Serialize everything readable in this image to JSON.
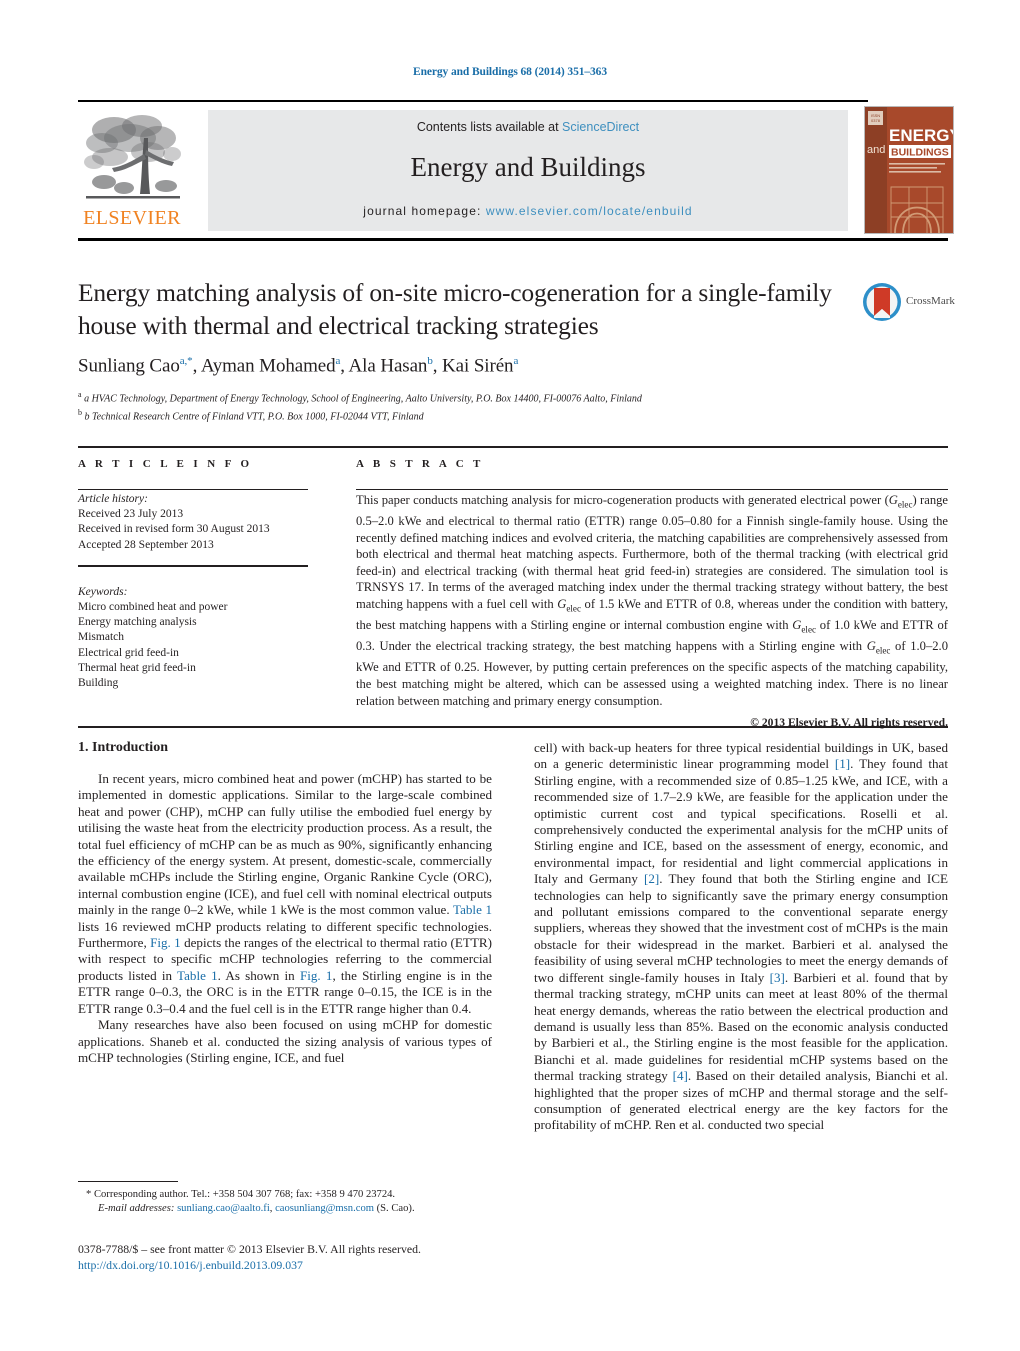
{
  "running_head": "Energy and Buildings 68 (2014) 351–363",
  "masthead": {
    "contents_prefix": "Contents lists available at ",
    "sciencedirect": "ScienceDirect",
    "journal_title": "Energy and Buildings",
    "homepage_prefix": "journal homepage: ",
    "homepage_url": "www.elsevier.com/locate/enbuild",
    "publisher": "ELSEVIER",
    "cover_line1": "ENERGY",
    "cover_line2": "and",
    "cover_line3": "BUILDINGS",
    "accent_orange": "#f08221",
    "link_blue": "#3e8fbf",
    "panel_grey": "#e7e8e9"
  },
  "crossmark": {
    "label": "CrossMark"
  },
  "title": "Energy matching analysis of on-site micro-cogeneration for a single-family house with thermal and electrical tracking strategies",
  "authors_html": "Sunliang Cao<sup>a,*</sup>, Ayman Mohamed<sup>a</sup>, Ala Hasan<sup>b</sup>, Kai Sirén<sup>a</sup>",
  "affiliations": [
    "a HVAC Technology, Department of Energy Technology, School of Engineering, Aalto University, P.O. Box 14400, FI-00076 Aalto, Finland",
    "b Technical Research Centre of Finland VTT, P.O. Box 1000, FI-02044 VTT, Finland"
  ],
  "article_info": {
    "heading": "A R T I C L E     I N F O",
    "history_label": "Article history:",
    "history": [
      "Received 23 July 2013",
      "Received in revised form 30 August 2013",
      "Accepted 28 September 2013"
    ],
    "keywords_label": "Keywords:",
    "keywords": [
      "Micro combined heat and power",
      "Energy matching analysis",
      "Mismatch",
      "Electrical grid feed-in",
      "Thermal heat grid feed-in",
      "Building"
    ]
  },
  "abstract": {
    "heading": "A B S T R A C T",
    "text": "This paper conducts matching analysis for micro-cogeneration products with generated electrical power (Gelec) range 0.5–2.0 kWe and electrical to thermal ratio (ETTR) range 0.05–0.80 for a Finnish single-family house. Using the recently defined matching indices and evolved criteria, the matching capabilities are comprehensively assessed from both electrical and thermal heat matching aspects. Furthermore, both of the thermal tracking (with electrical grid feed-in) and electrical tracking (with thermal heat grid feed-in) strategies are considered. The simulation tool is TRNSYS 17. In terms of the averaged matching index under the thermal tracking strategy without battery, the best matching happens with a fuel cell with Gelec of 1.5 kWe and ETTR of 0.8, whereas under the condition with battery, the best matching happens with a Stirling engine or internal combustion engine with Gelec of 1.0 kWe and ETTR of 0.3. Under the electrical tracking strategy, the best matching happens with a Stirling engine with Gelec of 1.0–2.0 kWe and ETTR of 0.25. However, by putting certain preferences on the specific aspects of the matching capability, the best matching might be altered, which can be assessed using a weighted matching index. There is no linear relation between matching and primary energy consumption.",
    "copyright": "© 2013 Elsevier B.V. All rights reserved."
  },
  "body": {
    "section_number_title": "1.  Introduction",
    "left_paragraph_1": "In recent years, micro combined heat and power (mCHP) has started to be implemented in domestic applications. Similar to the large-scale combined heat and power (CHP), mCHP can fully utilise the embodied fuel energy by utilising the waste heat from the electricity production process. As a result, the total fuel efficiency of mCHP can be as much as 90%, significantly enhancing the efficiency of the energy system. At present, domestic-scale, commercially available mCHPs include the Stirling engine, Organic Rankine Cycle (ORC), internal combustion engine (ICE), and fuel cell with nominal electrical outputs mainly in the range 0–2 kWe, while 1 kWe is the most common value. Table 1 lists 16 reviewed mCHP products relating to different specific technologies. Furthermore, Fig. 1 depicts the ranges of the electrical to thermal ratio (ETTR) with respect to specific mCHP technologies referring to the commercial products listed in Table 1. As shown in Fig. 1, the Stirling engine is in the ETTR range 0–0.3, the ORC is in the ETTR range 0–0.15, the ICE is in the ETTR range 0.3–0.4 and the fuel cell is in the ETTR range higher than 0.4.",
    "left_paragraph_2": "Many researches have also been focused on using mCHP for domestic applications. Shaneb et al. conducted the sizing analysis of various types of mCHP technologies (Stirling engine, ICE, and fuel",
    "right_paragraph": "cell) with back-up heaters for three typical residential buildings in UK, based on a generic deterministic linear programming model [1]. They found that Stirling engine, with a recommended size of 0.85–1.25 kWe, and ICE, with a recommended size of 1.7–2.9 kWe, are feasible for the application under the optimistic current cost and typical specifications. Roselli et al. comprehensively conducted the experimental analysis for the mCHP units of Stirling engine and ICE, based on the assessment of energy, economic, and environmental impact, for residential and light commercial applications in Italy and Germany [2]. They found that both the Stirling engine and ICE technologies can help to significantly save the primary energy consumption and pollutant emissions compared to the conventional separate energy suppliers, whereas they showed that the investment cost of mCHPs is the main obstacle for their widespread in the market. Barbieri et al. analysed the feasibility of using several mCHP technologies to meet the energy demands of two different single-family houses in Italy [3]. Barbieri et al. found that by thermal tracking strategy, mCHP units can meet at least 80% of the thermal heat energy demands, whereas the ratio between the electrical production and demand is usually less than 85%. Based on the economic analysis conducted by Barbieri et al., the Stirling engine is the most feasible for the application. Bianchi et al. made guidelines for residential mCHP systems based on the thermal tracking strategy [4]. Based on their detailed analysis, Bianchi et al. highlighted that the proper sizes of mCHP and thermal storage and the self-consumption of generated electrical energy are the key factors for the profitability of mCHP. Ren et al. conducted two special"
  },
  "footer": {
    "corresponding": "* Corresponding author. Tel.: +358 504 307 768; fax: +358 9 470 23724.",
    "email_label": "E-mail addresses:",
    "email_1": "sunliang.cao@aalto.fi",
    "email_2": "caosunliang@msn.com",
    "email_suffix": "(S. Cao).",
    "issn_line": "0378-7788/$ – see front matter © 2013 Elsevier B.V. All rights reserved.",
    "doi": "http://dx.doi.org/10.1016/j.enbuild.2013.09.037"
  }
}
